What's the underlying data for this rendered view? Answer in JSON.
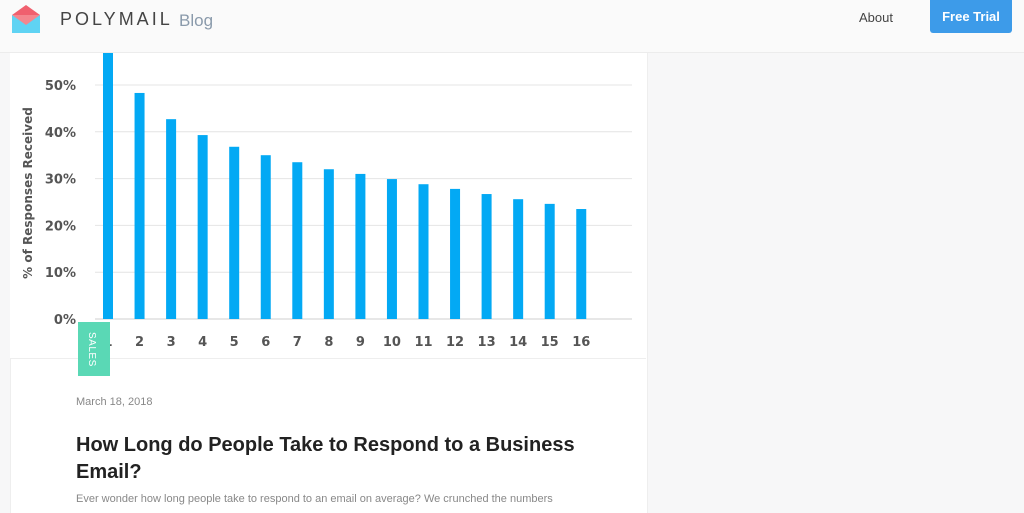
{
  "header": {
    "brand": "POLYMAIL",
    "brand_suffix": "Blog",
    "nav_about": "About",
    "cta": "Free Trial",
    "cta_color": "#3d9be9"
  },
  "post": {
    "category": "SALES",
    "category_color": "#5ad8b5",
    "date": "March 18, 2018",
    "title": "How Long do People Take to Respond to a Business Email?",
    "excerpt": "Ever wonder how long people take to respond to an email on average? We crunched the numbers"
  },
  "chart_data": {
    "type": "bar",
    "ylabel": "% of Responses Received",
    "categories": [
      "1",
      "2",
      "3",
      "4",
      "5",
      "6",
      "7",
      "8",
      "9",
      "10",
      "11",
      "12",
      "13",
      "14",
      "15",
      "16"
    ],
    "values": [
      57,
      48.3,
      42.7,
      39.3,
      36.8,
      35,
      33.5,
      32,
      31,
      29.9,
      28.8,
      27.8,
      26.7,
      25.6,
      24.6,
      23.5
    ],
    "yticks": [
      "0%",
      "10%",
      "20%",
      "30%",
      "40%",
      "50%"
    ],
    "ylim": [
      0,
      60
    ],
    "grid": true,
    "bar_color": "#03a9f4"
  }
}
